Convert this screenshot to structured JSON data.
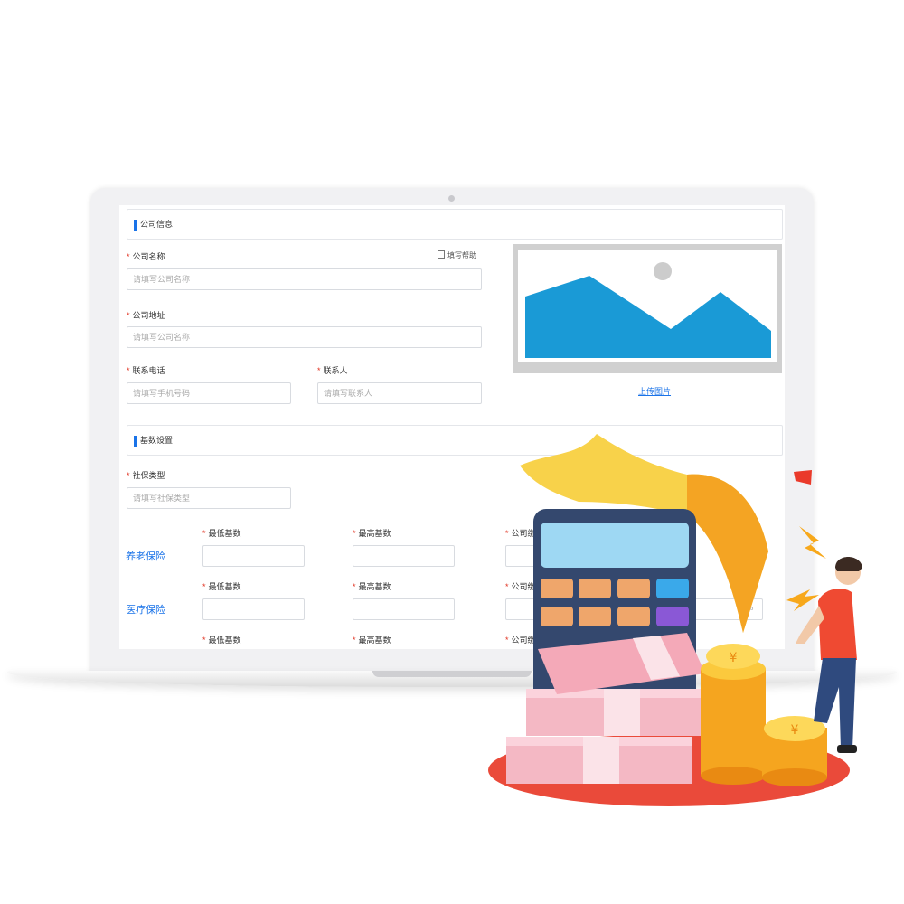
{
  "section_company": {
    "title": "公司信息"
  },
  "company_name": {
    "label": "公司名称",
    "placeholder": "请填写公司名称"
  },
  "help_link": {
    "label": "填写帮助"
  },
  "company_address": {
    "label": "公司地址",
    "placeholder": "请填写公司名称"
  },
  "phone": {
    "label": "联系电话",
    "placeholder": "请填写手机号码"
  },
  "contact": {
    "label": "联系人",
    "placeholder": "请填写联系人"
  },
  "upload_link": {
    "label": "上传图片"
  },
  "section_base": {
    "title": "基数设置"
  },
  "social_type": {
    "label": "社保类型",
    "placeholder": "请填写社保类型"
  },
  "insurance": [
    {
      "name": "养老保险",
      "min_label": "最低基数",
      "max_label": "最高基数",
      "company_label": "公司缴纳比例"
    },
    {
      "name": "医疗保险",
      "min_label": "最低基数",
      "max_label": "最高基数",
      "company_label": "公司缴纳比例"
    },
    {
      "name": "",
      "min_label": "最低基数",
      "max_label": "最高基数",
      "company_label": "公司缴纳比例"
    }
  ],
  "percent_symbol": "%",
  "coin_symbol": "¥",
  "colors": {
    "accent": "#1a73e8",
    "required": "#e0301e",
    "image_placeholder": "#1a9ad6"
  }
}
